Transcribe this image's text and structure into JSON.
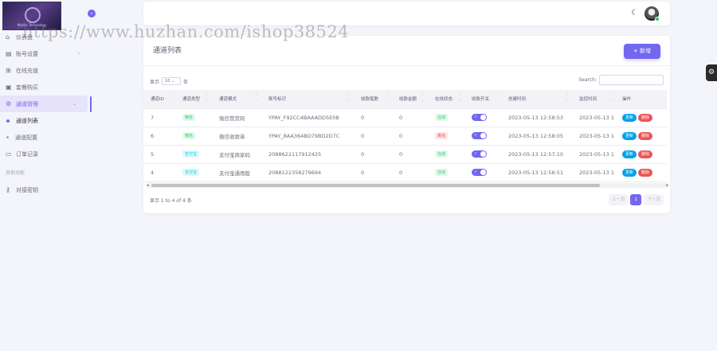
{
  "brand": {
    "logo_text": "Mobile Technology"
  },
  "watermark": "https://www.huzhan.com/ishop38524",
  "sidebar": {
    "collapse_icon": "‹",
    "items": [
      {
        "label": "仪表盘",
        "icon": "⌂",
        "has_arrow": false
      },
      {
        "label": "账号设置",
        "icon": "▤",
        "has_arrow": true
      },
      {
        "label": "在线充值",
        "icon": "⊞",
        "has_arrow": false
      },
      {
        "label": "套餐购买",
        "icon": "▣",
        "has_arrow": false
      },
      {
        "label": "通道管理",
        "icon": "⚙",
        "has_arrow": true,
        "active": true
      }
    ],
    "subitems": [
      {
        "label": "通道列表",
        "active": true
      },
      {
        "label": "通道配置",
        "active": false
      }
    ],
    "orders": {
      "label": "订单记录",
      "icon": "▭"
    },
    "section_title": "其他功能",
    "extra": {
      "label": "对接密钥",
      "icon": "⚷"
    }
  },
  "navbar": {
    "moon_icon": "☾"
  },
  "card": {
    "title": "通道列表",
    "add_button": "+ 新增",
    "length_prefix": "显示",
    "length_value": "10",
    "length_suffix": "条",
    "search_label": "Search:",
    "columns": [
      "通道ID",
      "通道类型",
      "通道模式",
      "账号标识",
      "收款笔数",
      "收款金额",
      "在线状态",
      "收款开关",
      "创建时间",
      "监控时间",
      "操作"
    ],
    "rows": [
      {
        "id": "7",
        "type": "微信",
        "type_color": "green",
        "mode": "微信赞赏码",
        "account": "YPAY_F92CC4BAAADD5E0B",
        "count": "0",
        "amount": "0",
        "status": "在线",
        "status_color": "green",
        "created": "2023-05-13 12:58:53",
        "monitor": "2023-05-13 1"
      },
      {
        "id": "6",
        "type": "微信",
        "type_color": "green",
        "mode": "微信收款单",
        "account": "YPAY_8AA364BD79BD2D7C",
        "count": "0",
        "amount": "0",
        "status": "离线",
        "status_color": "red",
        "created": "2023-05-13 12:58:05",
        "monitor": "2023-05-13 1"
      },
      {
        "id": "5",
        "type": "支付宝",
        "type_color": "blue",
        "mode": "支付宝商家码",
        "account": "2088622117912425",
        "count": "0",
        "amount": "0",
        "status": "在线",
        "status_color": "green",
        "created": "2023-05-13 12:57:10",
        "monitor": "2023-05-13 1"
      },
      {
        "id": "4",
        "type": "支付宝",
        "type_color": "blue",
        "mode": "支付宝通用版",
        "account": "2088122358279694",
        "count": "0",
        "amount": "0",
        "status": "在线",
        "status_color": "green",
        "created": "2023-05-13 12:56:51",
        "monitor": "2023-05-13 1"
      }
    ],
    "edit_label": "更新",
    "delete_label": "删除",
    "info": "显示 1 to 4 of 4 条",
    "pager": {
      "prev": "上一页",
      "current": "1",
      "next": "下一页"
    }
  },
  "fab_icon": "⚙"
}
